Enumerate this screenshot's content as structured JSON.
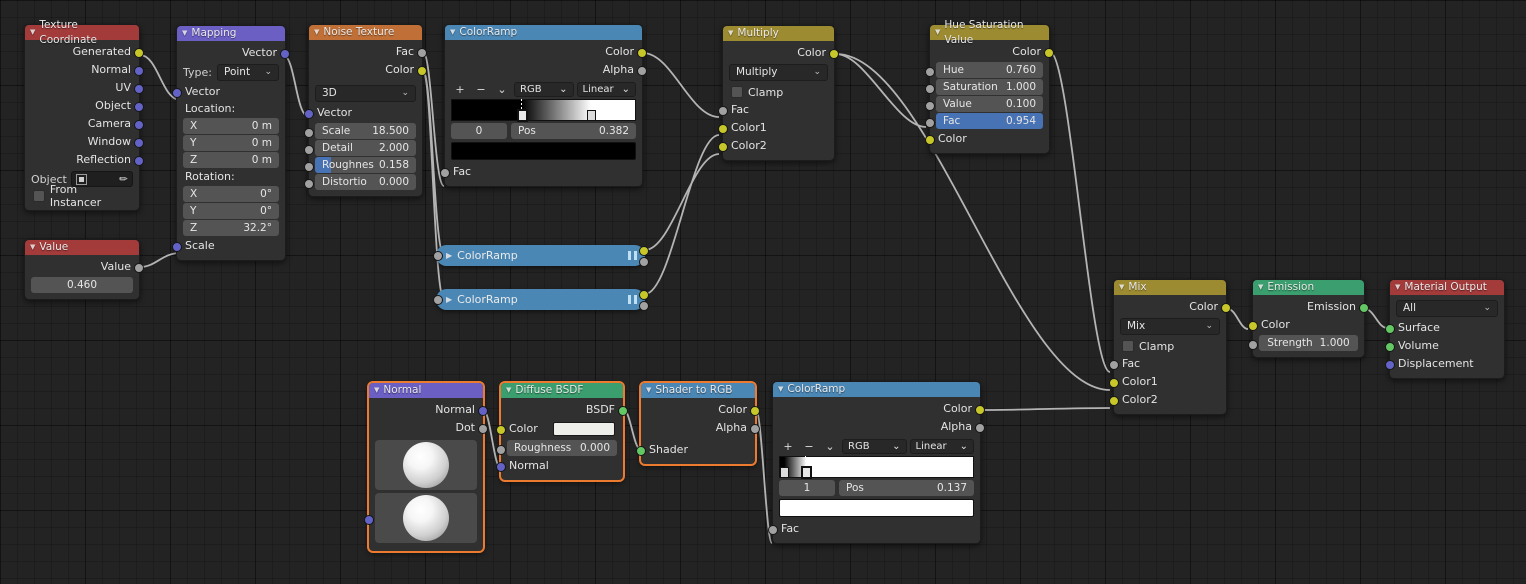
{
  "nodes": {
    "texcoord": {
      "title": "Texture Coordinate",
      "header_color": "#a33b3b",
      "outputs": [
        "Generated",
        "Normal",
        "UV",
        "Object",
        "Camera",
        "Window",
        "Reflection"
      ],
      "object_label": "Object",
      "from_instancer_label": "From Instancer"
    },
    "mapping": {
      "title": "Mapping",
      "header_color": "#6b5fc4",
      "output_label": "Vector",
      "type_label": "Type:",
      "type_value": "Point",
      "input_vector": "Vector",
      "location_label": "Location:",
      "location": [
        {
          "axis": "X",
          "value": "0 m"
        },
        {
          "axis": "Y",
          "value": "0 m"
        },
        {
          "axis": "Z",
          "value": "0 m"
        }
      ],
      "rotation_label": "Rotation:",
      "rotation": [
        {
          "axis": "X",
          "value": "0°"
        },
        {
          "axis": "Y",
          "value": "0°"
        },
        {
          "axis": "Z",
          "value": "32.2°"
        }
      ],
      "scale_label": "Scale"
    },
    "value": {
      "title": "Value",
      "header_color": "#a33b3b",
      "output_label": "Value",
      "value": "0.460"
    },
    "noise": {
      "title": "Noise Texture",
      "header_color": "#c07037",
      "outputs": [
        "Fac",
        "Color"
      ],
      "dimension": "3D",
      "input_vector": "Vector",
      "props": [
        {
          "label": "Scale",
          "value": "18.500"
        },
        {
          "label": "Detail",
          "value": "2.000"
        },
        {
          "label": "Roughnes",
          "value": "0.158"
        },
        {
          "label": "Distortio",
          "value": "0.000"
        }
      ]
    },
    "colorramp_top": {
      "title": "ColorRamp",
      "header_color": "#4b87b5",
      "outputs": [
        "Color",
        "Alpha"
      ],
      "add_label": "+",
      "remove_label": "−",
      "menu_label": "⌄",
      "interpolation_mode": "RGB",
      "interpolation": "Linear",
      "index": "0",
      "pos_label": "Pos",
      "pos_value": "0.382",
      "stops": [
        {
          "pos": 0.382,
          "color": "#000000",
          "active": true
        },
        {
          "pos": 0.76,
          "color": "#ffffff",
          "active": false
        }
      ],
      "swatch_color": "#000000",
      "input_fac": "Fac"
    },
    "colorramp_a": {
      "title": "ColorRamp",
      "header_color": "#4b87b5"
    },
    "colorramp_b": {
      "title": "ColorRamp",
      "header_color": "#4b87b5"
    },
    "multiply": {
      "title": "Multiply",
      "header_color": "#9d8b31",
      "output_label": "Color",
      "blend_mode": "Multiply",
      "clamp_label": "Clamp",
      "inputs": [
        "Fac",
        "Color1",
        "Color2"
      ]
    },
    "hsv": {
      "title": "Hue Saturation Value",
      "header_color": "#9d8b31",
      "output_label": "Color",
      "props": [
        {
          "label": "Hue",
          "value": "0.760",
          "highlight": false
        },
        {
          "label": "Saturation",
          "value": "1.000",
          "highlight": false
        },
        {
          "label": "Value",
          "value": "0.100",
          "highlight": false
        },
        {
          "label": "Fac",
          "value": "0.954",
          "highlight": true
        }
      ],
      "input_color": "Color"
    },
    "normal": {
      "title": "Normal",
      "header_color": "#6b5fc4",
      "outputs": [
        "Normal",
        "Dot"
      ],
      "selected": true
    },
    "diffuse": {
      "title": "Diffuse BSDF",
      "header_color": "#3a9e6e",
      "output_label": "BSDF",
      "color_label": "Color",
      "color_value": "#eeeeea",
      "roughness_label": "Roughness",
      "roughness_value": "0.000",
      "normal_label": "Normal",
      "selected": true
    },
    "shader2rgb": {
      "title": "Shader to RGB",
      "header_color": "#4b87b5",
      "outputs": [
        "Color",
        "Alpha"
      ],
      "input_shader": "Shader",
      "selected": true
    },
    "colorramp_bottom": {
      "title": "ColorRamp",
      "header_color": "#4b87b5",
      "outputs": [
        "Color",
        "Alpha"
      ],
      "add_label": "+",
      "remove_label": "−",
      "menu_label": "⌄",
      "interpolation_mode": "RGB",
      "interpolation": "Linear",
      "index": "1",
      "pos_label": "Pos",
      "pos_value": "0.137",
      "stops": [
        {
          "pos": 0.022,
          "color": "#000000",
          "active": false
        },
        {
          "pos": 0.137,
          "color": "#ffffff",
          "active": true
        }
      ],
      "swatch_color": "#ffffff",
      "input_fac": "Fac"
    },
    "mix": {
      "title": "Mix",
      "header_color": "#9d8b31",
      "output_label": "Color",
      "blend_mode": "Mix",
      "clamp_label": "Clamp",
      "inputs": [
        "Fac",
        "Color1",
        "Color2"
      ]
    },
    "emission": {
      "title": "Emission",
      "header_color": "#3a9e6e",
      "output_label": "Emission",
      "color_label": "Color",
      "strength_label": "Strength",
      "strength_value": "1.000"
    },
    "material_output": {
      "title": "Material Output",
      "header_color": "#a33b3b",
      "target": "All",
      "inputs": [
        "Surface",
        "Volume",
        "Displacement"
      ]
    }
  },
  "icons": {
    "collapse_triangle": "▼",
    "expand_triangle": "▶",
    "dropdown_chevron": "⌄",
    "eyedropper": "✐"
  }
}
